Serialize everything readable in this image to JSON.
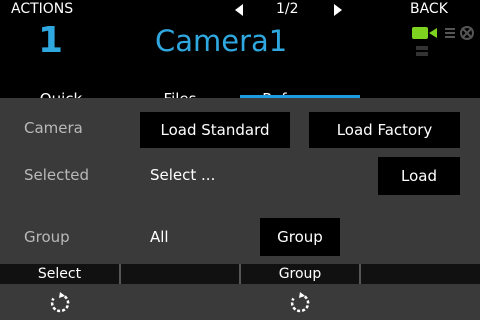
{
  "topbar": {
    "actions_label": "ACTIONS",
    "page_indicator": "1/2",
    "back_label": "BACK"
  },
  "camera": {
    "number": "1",
    "name": "Camera1"
  },
  "tabs": [
    {
      "label": "Quick",
      "active": false
    },
    {
      "label": "Files",
      "active": false
    },
    {
      "label": "Reference",
      "active": true
    }
  ],
  "rows": {
    "camera": {
      "label": "Camera",
      "btn_standard": "Load Standard",
      "btn_factory": "Load Factory"
    },
    "selected": {
      "label": "Selected",
      "value": "Select ...",
      "btn_load": "Load"
    },
    "group": {
      "label": "Group",
      "value": "All",
      "btn_group": "Group"
    }
  },
  "bottombar": {
    "cells": [
      "Select",
      "",
      "Group",
      ""
    ]
  },
  "colors": {
    "accent": "#2fa8e0",
    "underline": "#1e9be0",
    "rec": "#7ed321",
    "panel": "#3a3a3a"
  },
  "icons": {
    "rec": "camera-rec-icon",
    "network": "network-icon",
    "bars": "signal-bars-icon",
    "knob": "rotate-knob-icon"
  }
}
